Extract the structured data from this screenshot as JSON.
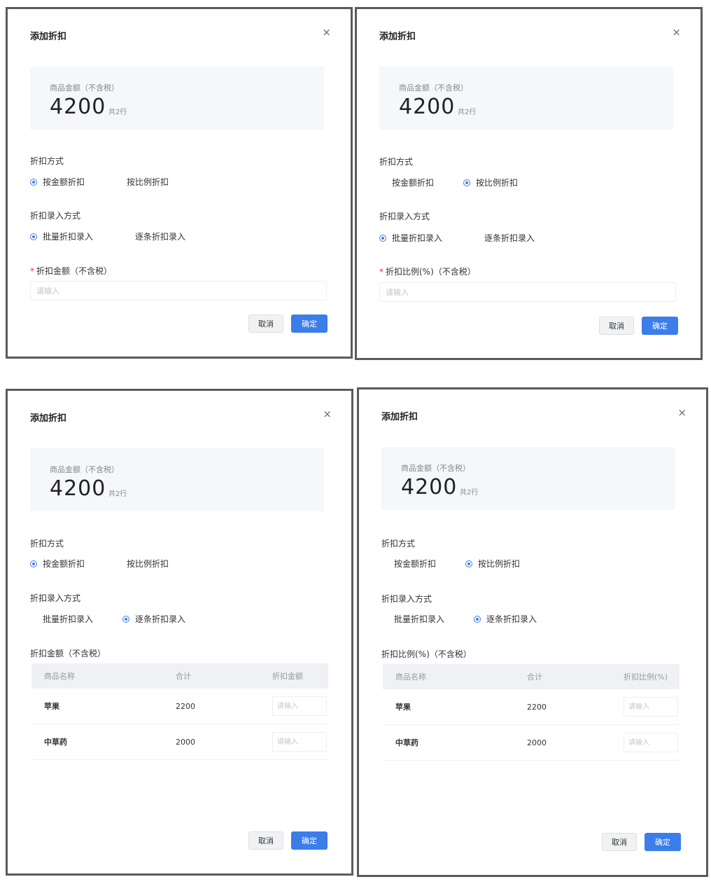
{
  "dialogs": [
    {
      "title": "添加折扣",
      "summary": {
        "label": "商品金额（不含税）",
        "amount": "4200",
        "count": "共2行"
      },
      "method": {
        "label": "折扣方式",
        "options": [
          "按金额折扣",
          "按比例折扣"
        ],
        "selected": 0
      },
      "entry": {
        "label": "折扣录入方式",
        "options": [
          "批量折扣录入",
          "逐条折扣录入"
        ],
        "selected": 0
      },
      "field": {
        "label": "折扣金额（不含税）",
        "placeholder": "请输入",
        "required": "*"
      },
      "buttons": {
        "cancel": "取消",
        "ok": "确定"
      }
    },
    {
      "title": "添加折扣",
      "summary": {
        "label": "商品金额（不含税）",
        "amount": "4200",
        "count": "共2行"
      },
      "method": {
        "label": "折扣方式",
        "options": [
          "按金额折扣",
          "按比例折扣"
        ],
        "selected": 1
      },
      "entry": {
        "label": "折扣录入方式",
        "options": [
          "批量折扣录入",
          "逐条折扣录入"
        ],
        "selected": 0
      },
      "field": {
        "label": "折扣比例(%)（不含税）",
        "placeholder": "请输入",
        "required": "*"
      },
      "buttons": {
        "cancel": "取消",
        "ok": "确定"
      }
    },
    {
      "title": "添加折扣",
      "summary": {
        "label": "商品金额（不含税）",
        "amount": "4200",
        "count": "共2行"
      },
      "method": {
        "label": "折扣方式",
        "options": [
          "按金额折扣",
          "按比例折扣"
        ],
        "selected": 0
      },
      "entry": {
        "label": "折扣录入方式",
        "options": [
          "批量折扣录入",
          "逐条折扣录入"
        ],
        "selected": 1
      },
      "table": {
        "label": "折扣金额（不含税）",
        "headers": [
          "商品名称",
          "合计",
          "折扣金额"
        ],
        "rows": [
          {
            "name": "苹果",
            "total": "2200",
            "placeholder": "请输入"
          },
          {
            "name": "中草药",
            "total": "2000",
            "placeholder": "请输入"
          }
        ]
      },
      "buttons": {
        "cancel": "取消",
        "ok": "确定"
      }
    },
    {
      "title": "添加折扣",
      "summary": {
        "label": "商品金额（不含税）",
        "amount": "4200",
        "count": "共2行"
      },
      "method": {
        "label": "折扣方式",
        "options": [
          "按金额折扣",
          "按比例折扣"
        ],
        "selected": 1
      },
      "entry": {
        "label": "折扣录入方式",
        "options": [
          "批量折扣录入",
          "逐条折扣录入"
        ],
        "selected": 1
      },
      "table": {
        "label": "折扣比例(%)（不含税）",
        "headers": [
          "商品名称",
          "合计",
          "折扣比例(%)"
        ],
        "rows": [
          {
            "name": "苹果",
            "total": "2200",
            "placeholder": "请输入"
          },
          {
            "name": "中草药",
            "total": "2000",
            "placeholder": "请输入"
          }
        ]
      },
      "buttons": {
        "cancel": "取消",
        "ok": "确定"
      }
    }
  ],
  "colors": {
    "primary": "#3b7de9",
    "summary_bg": "#f5f7fb",
    "frame": "#5b5b5b"
  },
  "icons": {
    "close": "close-icon"
  }
}
